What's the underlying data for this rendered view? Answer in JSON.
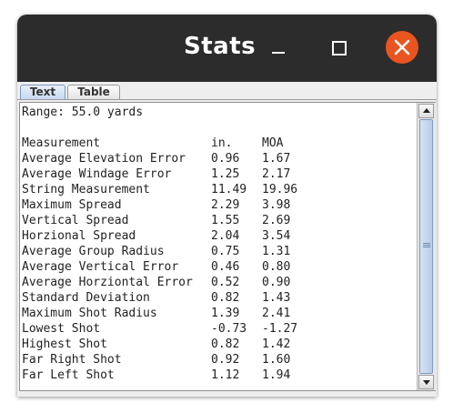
{
  "window": {
    "title": "Stats"
  },
  "tabs": [
    {
      "label": "Text",
      "selected": true
    },
    {
      "label": "Table",
      "selected": false
    }
  ],
  "text_output": {
    "range_line": "Range: 55.0 yards",
    "headers": [
      "Measurement",
      "in.",
      "MOA"
    ],
    "rows": [
      [
        "Average Elevation Error",
        "0.96",
        "1.67"
      ],
      [
        "Average Windage Error",
        "1.25",
        "2.17"
      ],
      [
        "String Measurement",
        "11.49",
        "19.96"
      ],
      [
        "Maximum Spread",
        "2.29",
        "3.98"
      ],
      [
        "Vertical Spread",
        "1.55",
        "2.69"
      ],
      [
        "Horzional Spread",
        "2.04",
        "3.54"
      ],
      [
        "Average Group Radius",
        "0.75",
        "1.31"
      ],
      [
        "Average Vertical Error",
        "0.46",
        "0.80"
      ],
      [
        "Average Horziontal Error",
        "0.52",
        "0.90"
      ],
      [
        "Standard Deviation",
        "0.82",
        "1.43"
      ],
      [
        "Maximum Shot Radius",
        "1.39",
        "2.41"
      ],
      [
        "Lowest Shot",
        "-0.73",
        "-1.27"
      ],
      [
        "Highest Shot",
        "0.82",
        "1.42"
      ],
      [
        "Far Right Shot",
        "0.92",
        "1.60"
      ],
      [
        "Far Left Shot",
        "1.12",
        "1.94"
      ]
    ]
  },
  "colors": {
    "titlebar": "#2c2c2c",
    "close_button": "#e95420",
    "tab_selected": "#c4d6ef",
    "scroll_thumb": "#b9cde9"
  },
  "icons": {
    "minimize": "minimize-icon",
    "maximize": "maximize-icon",
    "close": "close-icon",
    "scroll_up": "arrow-up-icon",
    "scroll_down": "arrow-down-icon"
  }
}
